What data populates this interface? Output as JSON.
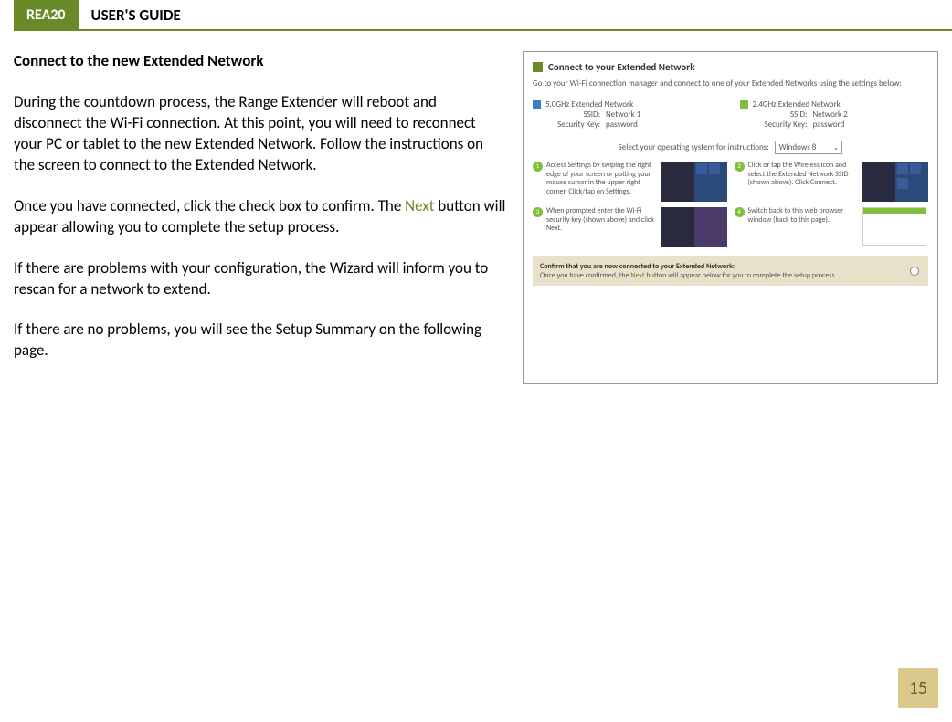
{
  "header": {
    "tab": "REA20",
    "title": "USER'S GUIDE"
  },
  "section_title": "Connect to the new Extended Network",
  "para1": "During the countdown process, the Range Extender will reboot and disconnect the Wi-Fi connection. At this point, you will need to reconnect your PC or tablet to the new Extended Network. Follow the instructions on the screen to connect to the Extended Network.",
  "para2a": "Once you have connected, click the check box to confirm. The ",
  "para2b": "Next",
  "para2c": " button will appear allowing you to complete the setup process.",
  "para3": "If there are problems with your configuration, the Wizard will inform you to rescan for a network to extend.",
  "para4": "If there are no problems, you will see the Setup Summary on the following page.",
  "shot": {
    "title": "Connect to your Extended Network",
    "subtitle": "Go to your Wi-Fi connection manager and connect to one of your Extended Networks using the settings below:",
    "net5": {
      "title": "5.0GHz Extended Network",
      "ssid_label": "SSID:",
      "ssid": "Network 1",
      "key_label": "Security Key:",
      "key": "password"
    },
    "net24": {
      "title": "2.4GHz Extended Network",
      "ssid_label": "SSID:",
      "ssid": "Network 2",
      "key_label": "Security Key:",
      "key": "password"
    },
    "os_label": "Select your operating system for instructions:",
    "os_value": "Windows 8",
    "steps": {
      "s1": "Access Settings by swiping the right edge of your screen or putting your mouse cursor in the upper right corner. Click/tap on Settings.",
      "s2": "Click or tap the Wireless icon and select the Extended Network SSID (shown above). Click Connect.",
      "s3": "When prompted enter the Wi-Fi security key (shown above) and click Next.",
      "s4": "Switch back to this web browser window (back to this page)."
    },
    "confirm_bold": "Confirm that you are now connected to your Extended Network:",
    "confirm_line": "Once you have confirmed, the ",
    "confirm_next": "Next",
    "confirm_line2": " button will appear below for you to complete the setup process."
  },
  "page_number": "15"
}
